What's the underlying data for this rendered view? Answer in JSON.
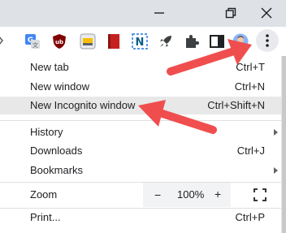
{
  "colors": {
    "annotation_arrow": "#f04e4e",
    "highlight_row": "#e8e8e8",
    "titlebar": "#dee1e6"
  },
  "window_controls": [
    {
      "name": "minimize-icon"
    },
    {
      "name": "restore-icon"
    },
    {
      "name": "close-icon"
    }
  ],
  "toolbar": {
    "extensions": [
      {
        "name": "translate-extension-icon"
      },
      {
        "name": "ublock-origin-extension-icon",
        "text": "ub"
      },
      {
        "name": "extension-grid-icon"
      },
      {
        "name": "red-book-extension-icon"
      },
      {
        "name": "n-extension-icon",
        "text": "N"
      },
      {
        "name": "rocket-extension-icon"
      },
      {
        "name": "puzzle-extensions-icon"
      },
      {
        "name": "side-panel-icon"
      },
      {
        "name": "profile-avatar-icon"
      }
    ],
    "menu_icon": "three-dots-vertical-icon"
  },
  "menu": {
    "items": [
      {
        "label": "New tab",
        "shortcut": "Ctrl+T"
      },
      {
        "label": "New window",
        "shortcut": "Ctrl+N"
      },
      {
        "label": "New Incognito window",
        "shortcut": "Ctrl+Shift+N",
        "highlighted": true
      },
      {
        "label": "History",
        "submenu": true
      },
      {
        "label": "Downloads",
        "shortcut": "Ctrl+J"
      },
      {
        "label": "Bookmarks",
        "submenu": true
      }
    ],
    "zoom": {
      "label": "Zoom",
      "minus": "−",
      "value": "100%",
      "plus": "+"
    },
    "print": {
      "label": "Print...",
      "shortcut": "Ctrl+P"
    }
  }
}
